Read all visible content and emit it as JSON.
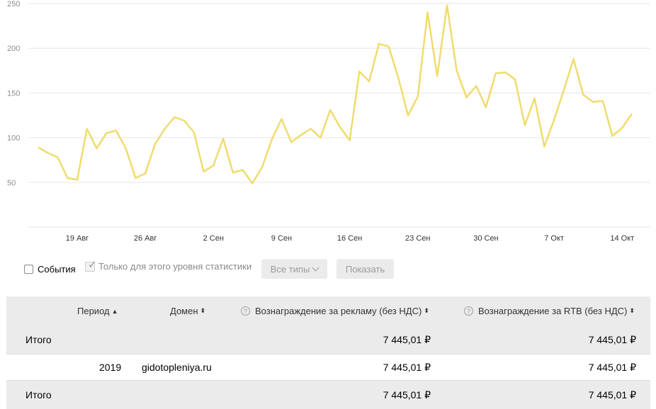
{
  "chart_data": {
    "type": "line",
    "color": "#f0dc6e",
    "ylim": [
      0,
      250
    ],
    "yticks": [
      50,
      100,
      150,
      200,
      250
    ],
    "xtick_labels": [
      "19 Авг",
      "26 Авг",
      "2 Сен",
      "9 Сен",
      "16 Сен",
      "23 Сен",
      "30 Сен",
      "7 Окт",
      "14 Окт"
    ],
    "xtick_index": [
      4,
      11,
      18,
      25,
      32,
      39,
      46,
      53,
      60
    ],
    "values": [
      89,
      83,
      78,
      55,
      53,
      110,
      88,
      105,
      108,
      88,
      55,
      60,
      93,
      110,
      123,
      119,
      106,
      62,
      69,
      99,
      61,
      64,
      49,
      67,
      98,
      121,
      95,
      103,
      110,
      100,
      131,
      112,
      97,
      174,
      163,
      205,
      202,
      167,
      125,
      146,
      240,
      169,
      248,
      175,
      145,
      158,
      134,
      172,
      173,
      165,
      114,
      144,
      90,
      120,
      153,
      188,
      148,
      140,
      141,
      102,
      111,
      127
    ]
  },
  "controls": {
    "events_label": "События",
    "level_only_label": "Только для этого уровня статистики",
    "types_button": "Все типы",
    "show_button": "Показать"
  },
  "table": {
    "headers": {
      "period": "Период",
      "period_sort": "▲",
      "domain": "Домен",
      "domain_sort": "⬍",
      "ad_reward": "Вознаграждение за рекламу (без НДС)",
      "ad_sort": "⬍",
      "rtb_reward": "Вознаграждение за RTB (без НДС)",
      "rtb_sort": "⬍",
      "help": "?"
    },
    "total_top": {
      "label": "Итого",
      "ad": "7 445,01 ₽",
      "rtb": "7 445,01 ₽"
    },
    "row": {
      "period": "2019",
      "domain": "gidotopleniya.ru",
      "ad": "7 445,01 ₽",
      "rtb": "7 445,01 ₽"
    },
    "total_bottom": {
      "label": "Итого",
      "ad": "7 445,01 ₽",
      "rtb": "7 445,01 ₽"
    }
  }
}
